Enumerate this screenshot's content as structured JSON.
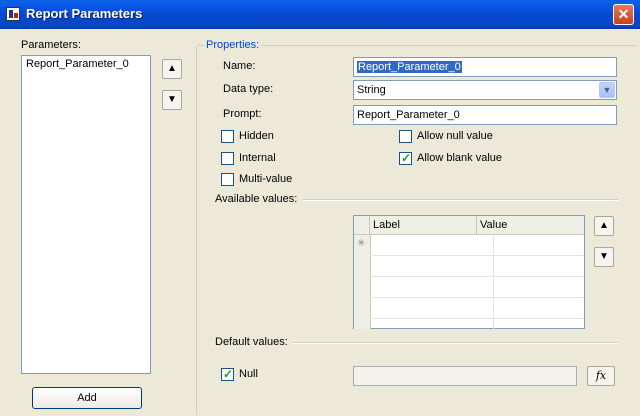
{
  "window": {
    "title": "Report Parameters",
    "close_glyph": "✕"
  },
  "parameters": {
    "label": "Parameters:",
    "items": [
      "Report_Parameter_0"
    ],
    "add_label": "Add"
  },
  "properties": {
    "group_label": "Properties:",
    "name_label": "Name:",
    "name_value": "Report_Parameter_0",
    "datatype_label": "Data type:",
    "datatype_value": "String",
    "prompt_label": "Prompt:",
    "prompt_value": "Report_Parameter_0",
    "hidden_label": "Hidden",
    "internal_label": "Internal",
    "multivalue_label": "Multi-value",
    "allow_null_label": "Allow null value",
    "allow_blank_label": "Allow blank value"
  },
  "checkboxes": {
    "hidden": false,
    "internal": false,
    "multivalue": false,
    "allow_null": false,
    "allow_blank": true,
    "null": true
  },
  "available": {
    "label": "Available values:",
    "col_label": "Label",
    "col_value": "Value",
    "new_row_glyph": "✳"
  },
  "defaults": {
    "label": "Default values:",
    "null_label": "Null",
    "fx_label": "fx"
  },
  "icons": {
    "up": "▲",
    "down": "▼",
    "combo": "▼"
  }
}
